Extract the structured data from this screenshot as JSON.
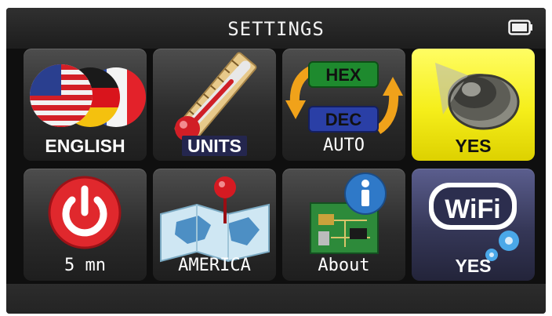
{
  "header": {
    "title": "SETTINGS",
    "battery_icon": "battery-full-icon"
  },
  "tiles": [
    {
      "label": "ENGLISH",
      "icon": "language-flags-icon"
    },
    {
      "label": "UNITS",
      "icon": "thermometer-ruler-icon"
    },
    {
      "label": "AUTO",
      "icon": "hex-dec-toggle-icon",
      "icon_text": [
        "HEX",
        "DEC"
      ]
    },
    {
      "label": "YES",
      "icon": "speaker-icon",
      "selected": true
    },
    {
      "label": "5 mn",
      "icon": "power-icon"
    },
    {
      "label": "AMERICA",
      "icon": "map-pin-icon"
    },
    {
      "label": "About",
      "icon": "info-board-icon"
    },
    {
      "label": "YES",
      "icon": "wifi-icon",
      "icon_text": "WiFi"
    }
  ],
  "colors": {
    "screen_bg": "#0f0f0f",
    "tile_bg": "#2c2c2c",
    "selected_tile": "#f5ee1a",
    "wifi_tile": "#353757"
  }
}
